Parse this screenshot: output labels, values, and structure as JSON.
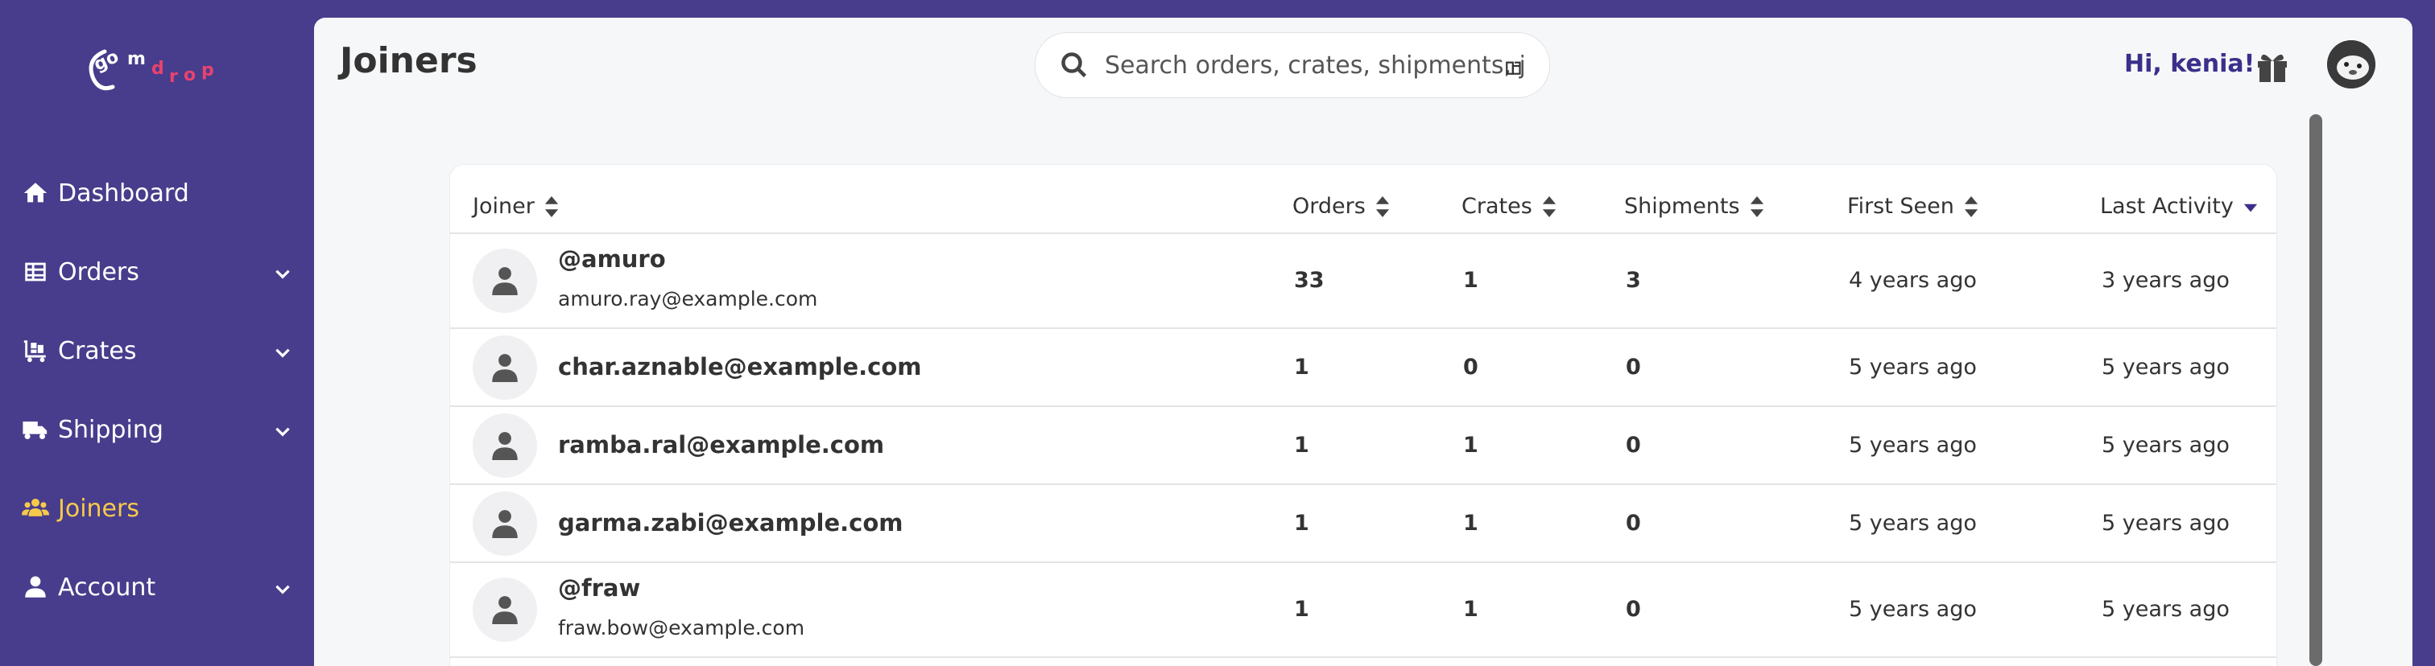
{
  "app": {
    "logo_text": "gomdrop"
  },
  "sidebar": {
    "items": [
      {
        "label": "Dashboard",
        "icon": "home-icon"
      },
      {
        "label": "Orders",
        "icon": "grid-icon"
      },
      {
        "label": "Crates",
        "icon": "dolly-icon"
      },
      {
        "label": "Shipping",
        "icon": "truck-icon"
      },
      {
        "label": "Joiners",
        "icon": "users-icon"
      },
      {
        "label": "Account",
        "icon": "user-icon"
      }
    ]
  },
  "header": {
    "title": "Joiners",
    "search_placeholder": "Search orders, crates, shipments, joi",
    "greeting": "Hi, kenia!"
  },
  "colors": {
    "brand": "#473d8c",
    "active": "#f7c94b",
    "accent_text": "#3a2f8a"
  },
  "table": {
    "columns": [
      "Joiner",
      "Orders",
      "Crates",
      "Shipments",
      "First Seen",
      "Last Activity"
    ],
    "rows": [
      {
        "name": "@amuro",
        "email": "amuro.ray@example.com",
        "orders": "33",
        "crates": "1",
        "shipments": "3",
        "first_seen": "4 years ago",
        "last_activity": "3 years ago"
      },
      {
        "name": "char.aznable@example.com",
        "email": "",
        "orders": "1",
        "crates": "0",
        "shipments": "0",
        "first_seen": "5 years ago",
        "last_activity": "5 years ago"
      },
      {
        "name": "ramba.ral@example.com",
        "email": "",
        "orders": "1",
        "crates": "1",
        "shipments": "0",
        "first_seen": "5 years ago",
        "last_activity": "5 years ago"
      },
      {
        "name": "garma.zabi@example.com",
        "email": "",
        "orders": "1",
        "crates": "1",
        "shipments": "0",
        "first_seen": "5 years ago",
        "last_activity": "5 years ago"
      },
      {
        "name": "@fraw",
        "email": "fraw.bow@example.com",
        "orders": "1",
        "crates": "1",
        "shipments": "0",
        "first_seen": "5 years ago",
        "last_activity": "5 years ago"
      }
    ]
  }
}
